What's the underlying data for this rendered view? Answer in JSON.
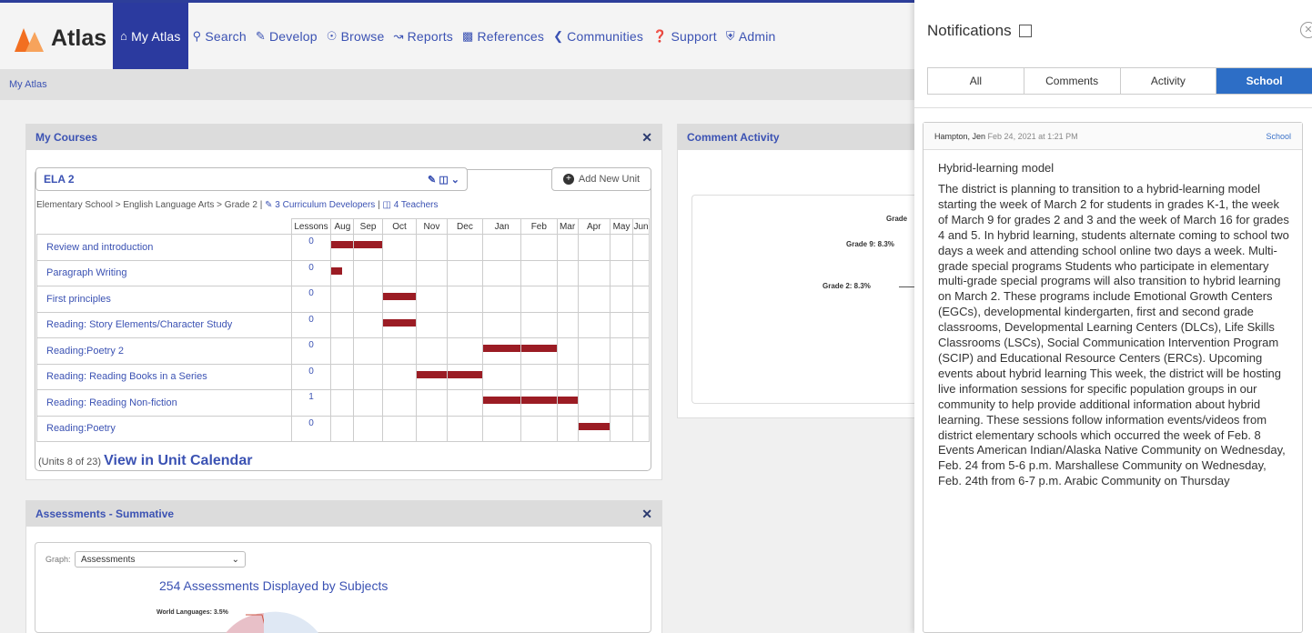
{
  "app": {
    "name": "Atlas"
  },
  "colors": {
    "accent": "#2b3a9f",
    "link": "#3b52b3",
    "bar": "#9b1c24",
    "school_tab": "#2d6ec6",
    "logo_orange": "#f26f21"
  },
  "nav": {
    "items": [
      {
        "label": "My Atlas",
        "icon": "home-icon",
        "glyph": "🏠"
      },
      {
        "label": "Search",
        "icon": "search-icon"
      },
      {
        "label": "Develop",
        "icon": "edit-icon"
      },
      {
        "label": "Browse",
        "icon": "globe-icon"
      },
      {
        "label": "Reports",
        "icon": "chart-icon"
      },
      {
        "label": "References",
        "icon": "book-icon"
      },
      {
        "label": "Communities",
        "icon": "share-icon"
      },
      {
        "label": "Support",
        "icon": "help-icon"
      },
      {
        "label": "Admin",
        "icon": "shield-icon"
      }
    ]
  },
  "breadcrumb": "My Atlas",
  "my_courses": {
    "title": "My Courses",
    "course": "ELA 2",
    "add_unit": "Add New Unit",
    "path": "Elementary School > English Language Arts > Grade 2 |",
    "developers": "3 Curriculum Developers",
    "separator": "|",
    "teachers": "4 Teachers",
    "columns": [
      "Lessons",
      "Aug",
      "Sep",
      "Oct",
      "Nov",
      "Dec",
      "Jan",
      "Feb",
      "Mar",
      "Apr",
      "May",
      "Jun"
    ],
    "units": [
      {
        "name": "Review and introduction",
        "lessons": "0",
        "span": [
          1,
          2
        ]
      },
      {
        "name": "Paragraph Writing",
        "lessons": "0",
        "span": [
          1,
          1
        ]
      },
      {
        "name": "First principles",
        "lessons": "0",
        "span": [
          3,
          3
        ]
      },
      {
        "name": "Reading: Story Elements/Character Study",
        "lessons": "0",
        "span": [
          3,
          3
        ]
      },
      {
        "name": "Reading:Poetry 2",
        "lessons": "0",
        "span": [
          6,
          7
        ]
      },
      {
        "name": "Reading: Reading Books in a Series",
        "lessons": "0",
        "span": [
          4,
          5
        ]
      },
      {
        "name": "Reading: Reading Non-fiction",
        "lessons": "1",
        "span": [
          6,
          8
        ]
      },
      {
        "name": "Reading:Poetry",
        "lessons": "0",
        "span": [
          9,
          9
        ]
      }
    ],
    "units_count": "(Units 8 of 23)",
    "calendar_link": "View in Unit Calendar"
  },
  "comment_activity": {
    "title": "Comment Activity",
    "labels": {
      "grade_top": "Grade",
      "grade9": "Grade 9: 8.3%",
      "grade2": "Grade 2: 8.3%"
    }
  },
  "assessments": {
    "title": "Assessments - Summative",
    "graph_label": "Graph:",
    "graph_value": "Assessments",
    "chart_title": "254 Assessments Displayed by Subjects",
    "pie_label": "World Languages: 3.5%"
  },
  "notifications": {
    "title": "Notifications",
    "tabs": [
      "All",
      "Comments",
      "Activity",
      "School"
    ],
    "active_tab": "School",
    "card": {
      "author": "Hampton, Jen",
      "date": "Feb 24, 2021 at 1:21 PM",
      "tag": "School",
      "subject": "Hybrid-learning model",
      "body": "The district is planning to transition to a hybrid-learning model starting the week of March 2 for students in grades K-1, the week of March 9 for grades 2 and 3 and the week of March 16 for grades 4 and 5. In hybrid learning, students alternate coming to school two days a week and attending school online two days a week. Multi-grade special programs Students who participate in elementary multi-grade special programs will also transition to hybrid learning on March 2. These programs include Emotional Growth Centers (EGCs), developmental kindergarten, first and second grade classrooms, Developmental Learning Centers (DLCs), Life Skills Classrooms (LSCs), Social Communication Intervention Program (SCIP) and Educational Resource Centers (ERCs). Upcoming events about hybrid learning This week, the district will be hosting live information sessions for specific population groups in our community to help provide additional information about hybrid learning. These sessions follow information events/videos from district elementary schools which occurred the week of Feb. 8 Events American Indian/Alaska Native Community on Wednesday, Feb. 24 from 5-6 p.m. Marshallese Community on Wednesday, Feb. 24th from 6-7 p.m. Arabic Community on Thursday"
    }
  }
}
